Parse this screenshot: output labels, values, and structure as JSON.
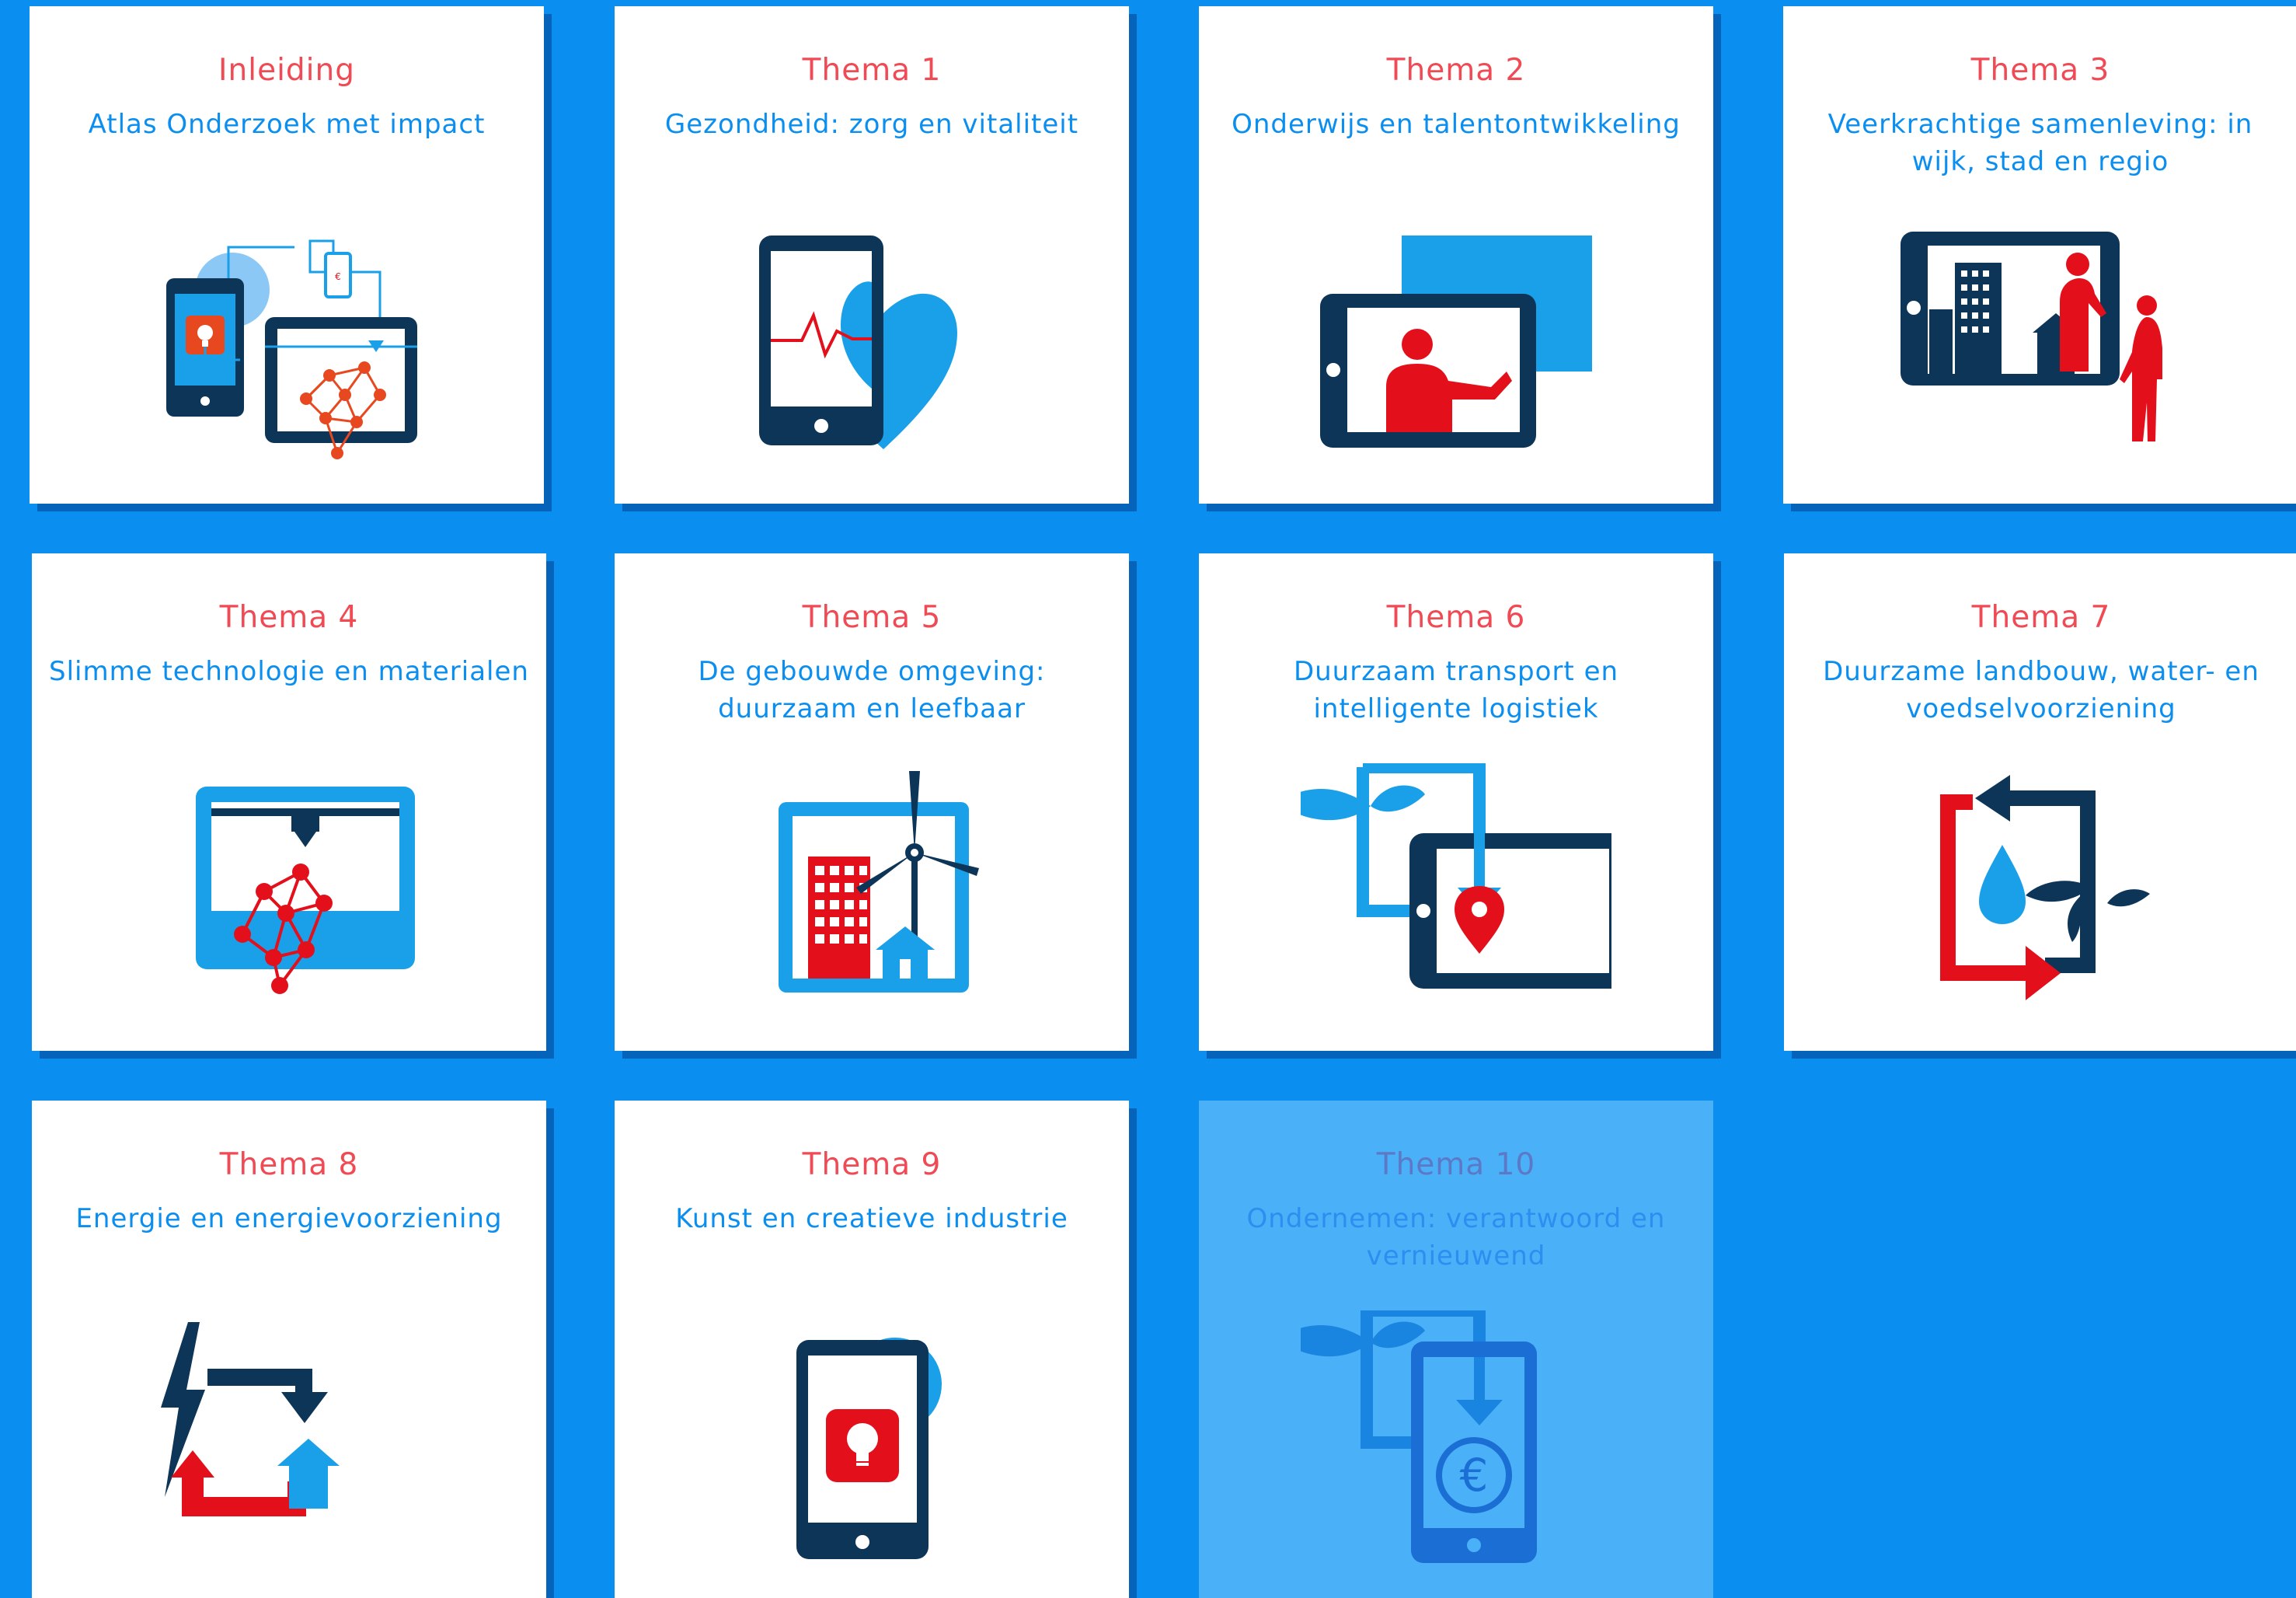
{
  "cards": [
    {
      "kicker": "Inleiding",
      "title": "Atlas Onderzoek met impact",
      "icon": "research-impact-icon"
    },
    {
      "kicker": "Thema 1",
      "title": "Gezondheid: zorg en vitaliteit",
      "icon": "health-heart-phone-icon"
    },
    {
      "kicker": "Thema 2",
      "title": "Onderwijs en talentontwikkeling",
      "icon": "education-tablet-icon"
    },
    {
      "kicker": "Thema 3",
      "title": "Veerkrachtige samenleving: in wijk, stad en regio",
      "icon": "city-community-icon"
    },
    {
      "kicker": "Thema 4",
      "title": "Slimme technologie en materialen",
      "icon": "3d-printer-icon"
    },
    {
      "kicker": "Thema 5",
      "title": "De gebouwde omgeving: duurzaam en leefbaar",
      "icon": "building-windmill-icon"
    },
    {
      "kicker": "Thema 6",
      "title": "Duurzaam transport en intelligente logistiek",
      "icon": "logistics-location-icon"
    },
    {
      "kicker": "Thema 7",
      "title": "Duurzame landbouw, water- en voedselvoorziening",
      "icon": "water-leaf-cycle-icon"
    },
    {
      "kicker": "Thema 8",
      "title": "Energie en energievoorziening",
      "icon": "energy-cycle-icon"
    },
    {
      "kicker": "Thema 9",
      "title": "Kunst en creatieve industrie",
      "icon": "creative-lightbulb-phone-icon"
    },
    {
      "kicker": "Thema 10",
      "title": "Ondernemen: verantwoord en vernieuwend",
      "icon": "euro-phone-icon"
    }
  ],
  "colors": {
    "background": "#0a8ef0",
    "card": "#ffffff",
    "card_faded": "#4ab0f7",
    "kicker": "#f04b55",
    "title": "#0a8ef0",
    "navy": "#0d3558",
    "red": "#e3101c",
    "light_blue": "#1aa0e8"
  }
}
